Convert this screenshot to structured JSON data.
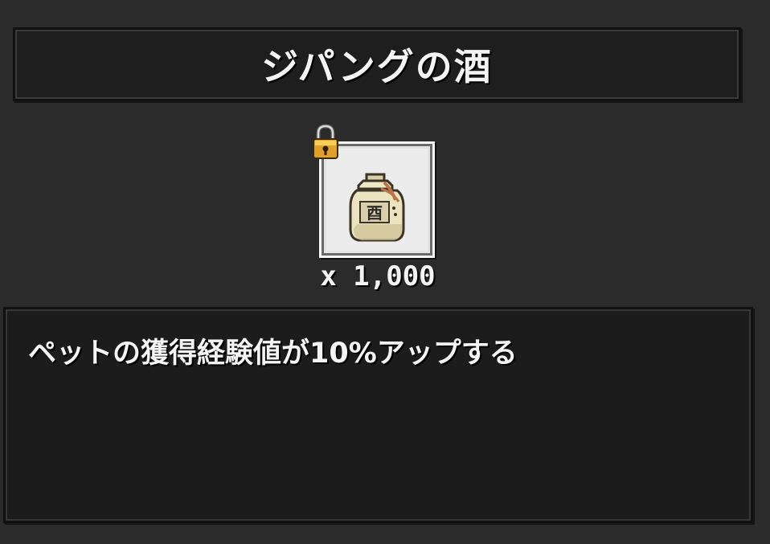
{
  "item": {
    "name": "ジパングの酒",
    "quantity": "x 1,000",
    "description": "ペットの獲得経験値が10%アップする",
    "icon": "sake-jar-icon",
    "jar_label": "酉",
    "locked": true,
    "lock_icon": "padlock-icon"
  },
  "colors": {
    "background": "#2b2b2b",
    "panel": "#1e1e1e",
    "text": "#f4f4f4",
    "slot": "#ececec"
  }
}
